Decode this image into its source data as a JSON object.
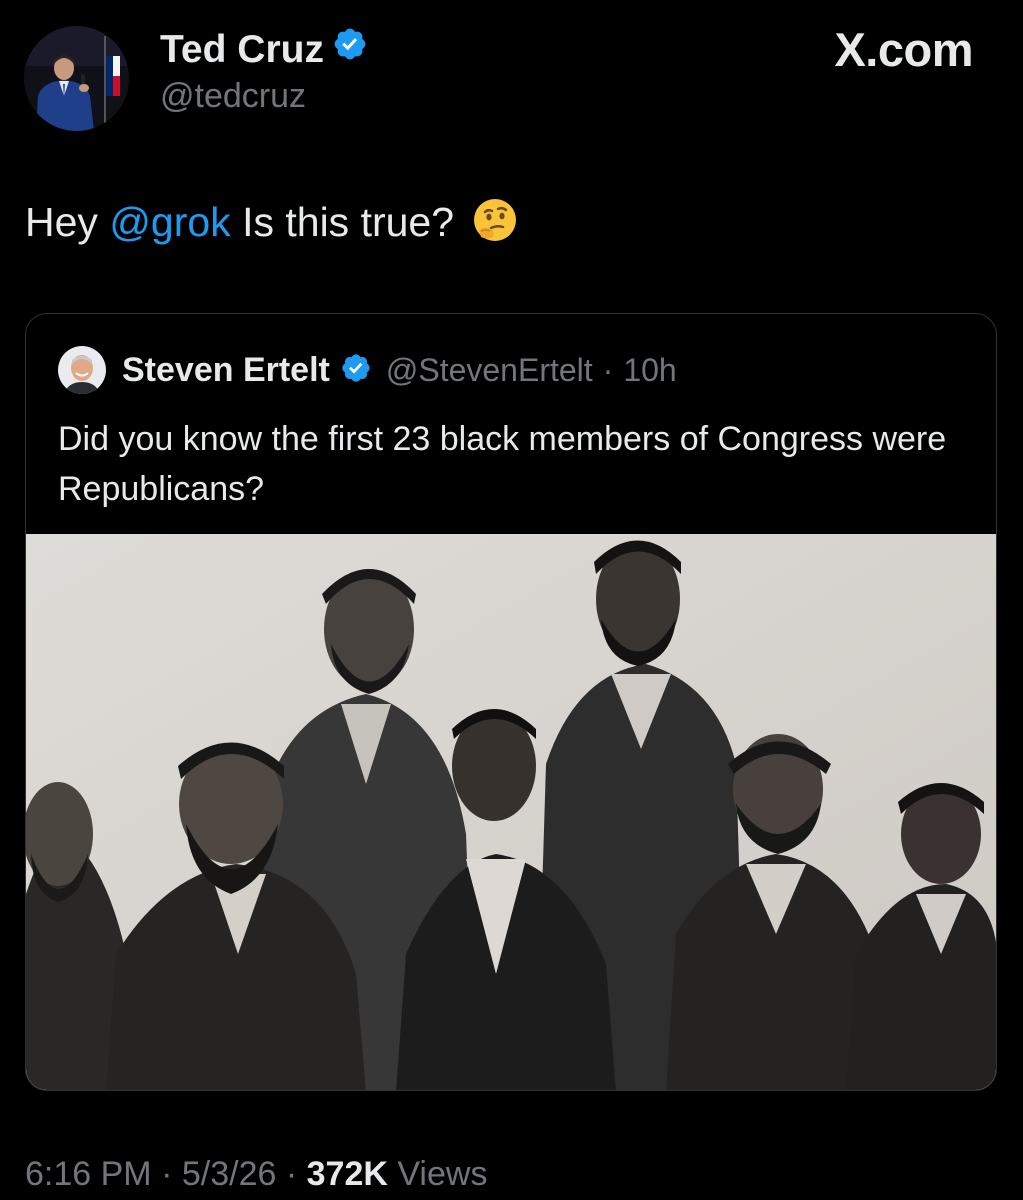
{
  "site": {
    "logo": "X.com"
  },
  "author": {
    "name": "Ted Cruz",
    "handle": "@tedcruz",
    "verified": true
  },
  "tweet": {
    "text_before": "Hey ",
    "mention": "@grok",
    "text_after": " Is this true?",
    "emoji": "thinking-face-icon"
  },
  "quoted": {
    "name": "Steven Ertelt",
    "handle": "@StevenErtelt",
    "separator": "·",
    "time": "10h",
    "verified": true,
    "text": "Did you know the first 23 black members of Congress were Republicans?"
  },
  "meta": {
    "time": "6:16 PM",
    "sep1": "·",
    "date": "5/3/26",
    "sep2": "·",
    "views_count": "372K",
    "views_label": "Views"
  },
  "colors": {
    "background": "#000000",
    "text": "#e7e9ea",
    "muted": "#71767b",
    "link": "#1d9bf0",
    "border": "#2f3336"
  }
}
